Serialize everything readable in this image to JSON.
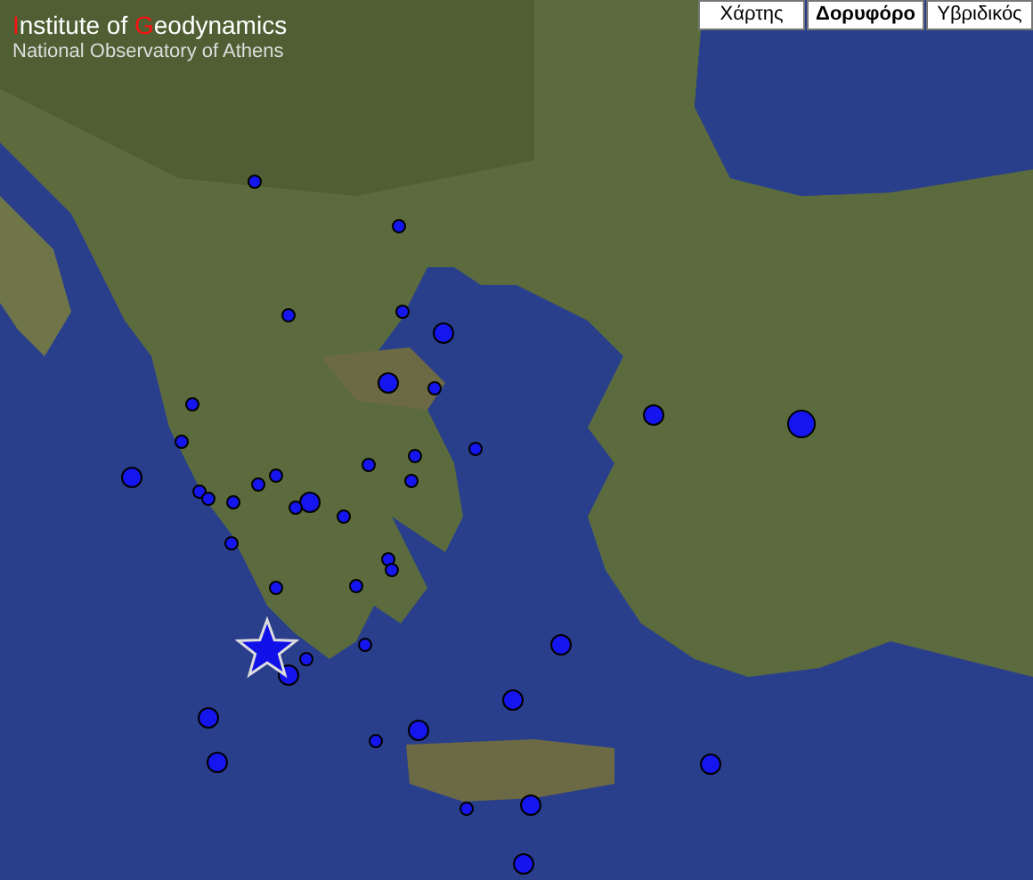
{
  "logo": {
    "title_parts": [
      {
        "text": "I",
        "accent": true
      },
      {
        "text": "nstitute of ",
        "accent": false
      },
      {
        "text": "G",
        "accent": true
      },
      {
        "text": "eodynamics",
        "accent": false
      }
    ],
    "subtitle": "National Observatory of Athens"
  },
  "map_types": [
    {
      "label": "Χάρτης",
      "selected": false
    },
    {
      "label": "Δορυφόρο",
      "selected": true
    },
    {
      "label": "Υβριδικός",
      "selected": false
    }
  ]
}
